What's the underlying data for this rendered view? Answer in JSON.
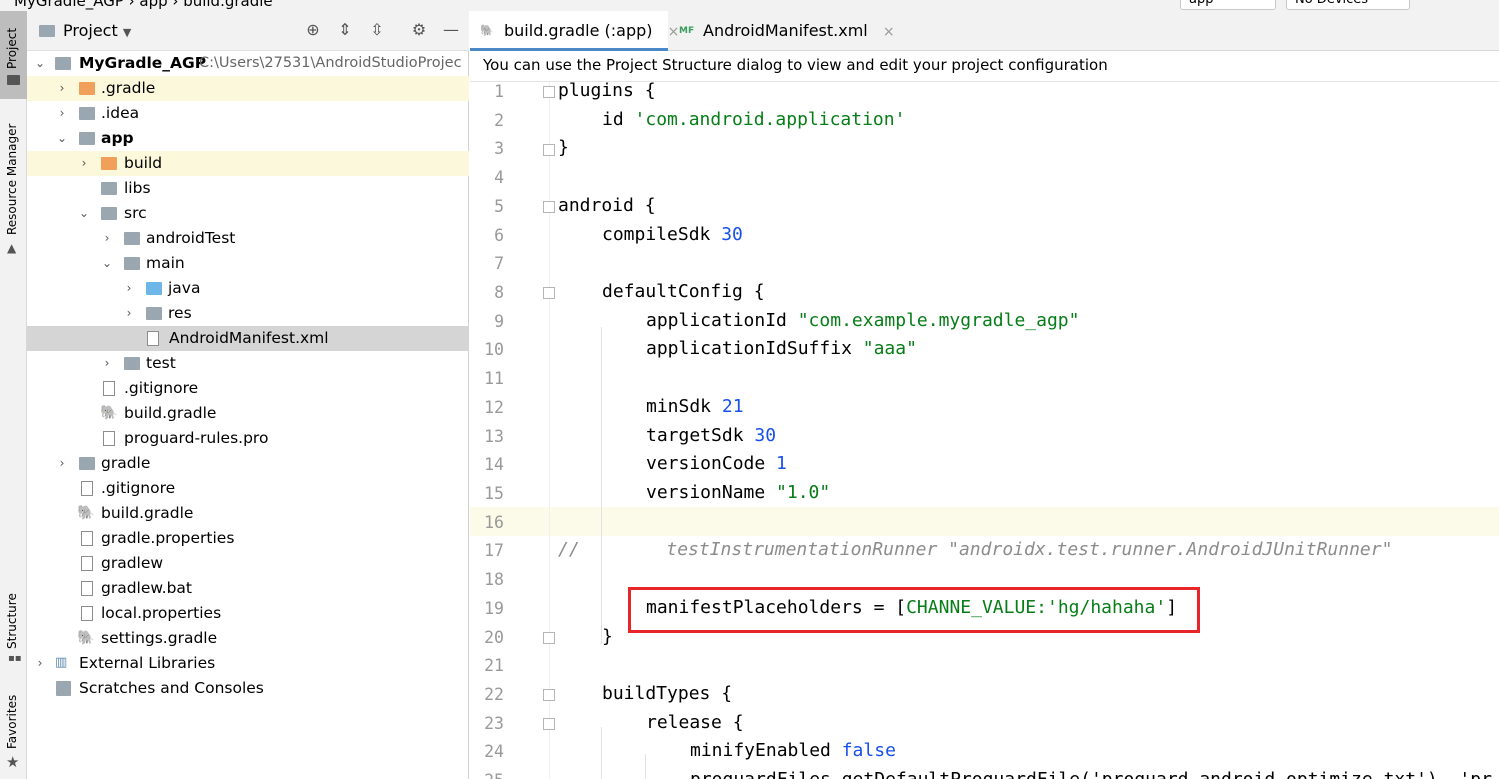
{
  "topbar": {
    "crumb": "MyGradle_AGP  ›  app  ›  build.gradle",
    "run_config": "app",
    "device": "No Devices"
  },
  "left_strip": {
    "project_label": "Project",
    "resource_manager_label": "Resource Manager",
    "structure_label": "Structure",
    "favorites_label": "Favorites"
  },
  "project_panel": {
    "title": "Project",
    "tree": [
      {
        "label": "MyGradle_AGP",
        "path": "C:\\Users\\27531\\AndroidStudioProjec",
        "bold": true
      },
      {
        "label": ".gradle"
      },
      {
        "label": ".idea"
      },
      {
        "label": "app",
        "bold": true
      },
      {
        "label": "build"
      },
      {
        "label": "libs"
      },
      {
        "label": "src"
      },
      {
        "label": "androidTest"
      },
      {
        "label": "main"
      },
      {
        "label": "java"
      },
      {
        "label": "res"
      },
      {
        "label": "AndroidManifest.xml"
      },
      {
        "label": "test"
      },
      {
        "label": ".gitignore"
      },
      {
        "label": "build.gradle"
      },
      {
        "label": "proguard-rules.pro"
      },
      {
        "label": "gradle"
      },
      {
        "label": ".gitignore"
      },
      {
        "label": "build.gradle"
      },
      {
        "label": "gradle.properties"
      },
      {
        "label": "gradlew"
      },
      {
        "label": "gradlew.bat"
      },
      {
        "label": "local.properties"
      },
      {
        "label": "settings.gradle"
      },
      {
        "label": "External Libraries"
      },
      {
        "label": "Scratches and Consoles"
      }
    ]
  },
  "editor": {
    "tabs": [
      {
        "label": "build.gradle (:app)",
        "close": "×"
      },
      {
        "label": "AndroidManifest.xml",
        "close": "×"
      }
    ],
    "banner": "You can use the Project Structure dialog to view and edit your project configuration",
    "line_numbers": [
      "1",
      "2",
      "3",
      "4",
      "5",
      "6",
      "7",
      "8",
      "9",
      "10",
      "11",
      "12",
      "13",
      "14",
      "15",
      "16",
      "17",
      "18",
      "19",
      "20",
      "21",
      "22",
      "23",
      "24",
      "25"
    ],
    "code": {
      "l1": "plugins {",
      "l2_key": "id ",
      "l2_str": "'com.android.application'",
      "l3": "}",
      "l5": "android {",
      "l6_key": "compileSdk ",
      "l6_num": "30",
      "l8": "defaultConfig {",
      "l9_key": "applicationId ",
      "l9_str": "\"com.example.mygradle_agp\"",
      "l10_key": "applicationIdSuffix ",
      "l10_str": "\"aaa\"",
      "l12_key": "minSdk ",
      "l12_num": "21",
      "l13_key": "targetSdk ",
      "l13_num": "30",
      "l14_key": "versionCode ",
      "l14_num": "1",
      "l15_key": "versionName ",
      "l15_str": "\"1.0\"",
      "l17": "//        testInstrumentationRunner \"androidx.test.runner.AndroidJUnitRunner\"",
      "l19_key": "manifestPlaceholders = [",
      "l19_map": "CHANNE_VALUE:",
      "l19_str": "'hg/hahaha'",
      "l19_end": "]",
      "l20": "}",
      "l22": "buildTypes {",
      "l23": "release {",
      "l24_key": "minifyEnabled ",
      "l24_kw": "false",
      "l25": "proguardFiles getDefaultProguardFile('proguard-android-optimize.txt'), 'pr"
    }
  },
  "colors": {
    "string": "#067d17",
    "number": "#1750eb",
    "comment": "#8c8c8c",
    "highlight_box": "#e8262a"
  }
}
